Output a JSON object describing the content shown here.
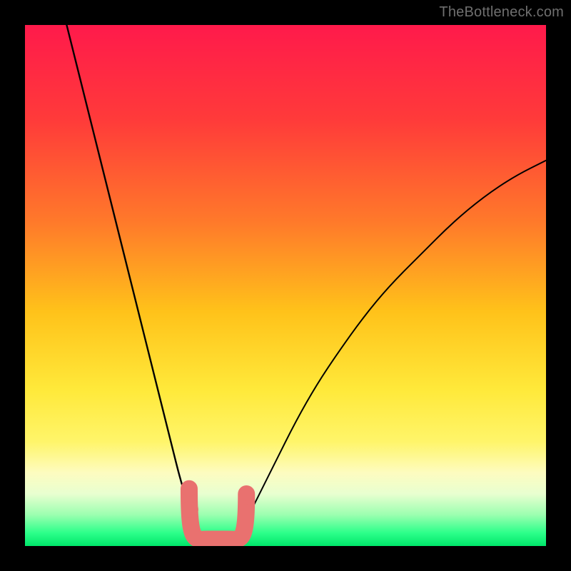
{
  "watermark": "TheBottleneck.com",
  "chart_data": {
    "type": "line",
    "title": "",
    "xlabel": "",
    "ylabel": "",
    "xlim": [
      0,
      100
    ],
    "ylim": [
      0,
      100
    ],
    "grid": false,
    "gradient_stops": [
      {
        "offset": 0,
        "color": "#ff1a4b"
      },
      {
        "offset": 0.18,
        "color": "#ff3a3a"
      },
      {
        "offset": 0.38,
        "color": "#ff7a2a"
      },
      {
        "offset": 0.55,
        "color": "#ffc21a"
      },
      {
        "offset": 0.7,
        "color": "#ffe93a"
      },
      {
        "offset": 0.8,
        "color": "#fff56a"
      },
      {
        "offset": 0.86,
        "color": "#fdfcc0"
      },
      {
        "offset": 0.9,
        "color": "#e8ffd0"
      },
      {
        "offset": 0.94,
        "color": "#9cffb0"
      },
      {
        "offset": 0.975,
        "color": "#2cff8a"
      },
      {
        "offset": 1.0,
        "color": "#00e66a"
      }
    ],
    "series": [
      {
        "name": "left-curve",
        "x": [
          8,
          10,
          12,
          14,
          16,
          18,
          20,
          22,
          24,
          26,
          28,
          30,
          32,
          33.5
        ],
        "y": [
          100,
          92,
          84,
          76,
          68,
          60,
          52,
          44,
          36,
          28,
          20,
          12,
          6,
          2
        ],
        "note": "y is drawn from top; visually this descends from top-left into the valley"
      },
      {
        "name": "right-curve",
        "x": [
          41,
          44,
          48,
          52,
          56,
          60,
          65,
          70,
          76,
          82,
          88,
          94,
          100
        ],
        "y": [
          2,
          8,
          16,
          24,
          31,
          37,
          44,
          50,
          56,
          62,
          67,
          71,
          74
        ],
        "note": "rises from the valley up to the right edge about 3/4 height"
      },
      {
        "name": "valley-fill-shape",
        "type": "area",
        "x": [
          29,
          30.5,
          32.5,
          34,
          36,
          38,
          40,
          41.5,
          43,
          43.5,
          42,
          40,
          38,
          36,
          34,
          32,
          30,
          29
        ],
        "y": [
          12,
          8,
          5,
          3,
          2,
          2,
          3,
          5,
          8,
          11,
          6,
          3,
          1.5,
          1,
          1.5,
          3,
          7,
          12
        ],
        "note": "sausage-shaped coral blob sitting at the bottom of the V"
      }
    ],
    "valley_min_x": 37,
    "annotations": []
  }
}
